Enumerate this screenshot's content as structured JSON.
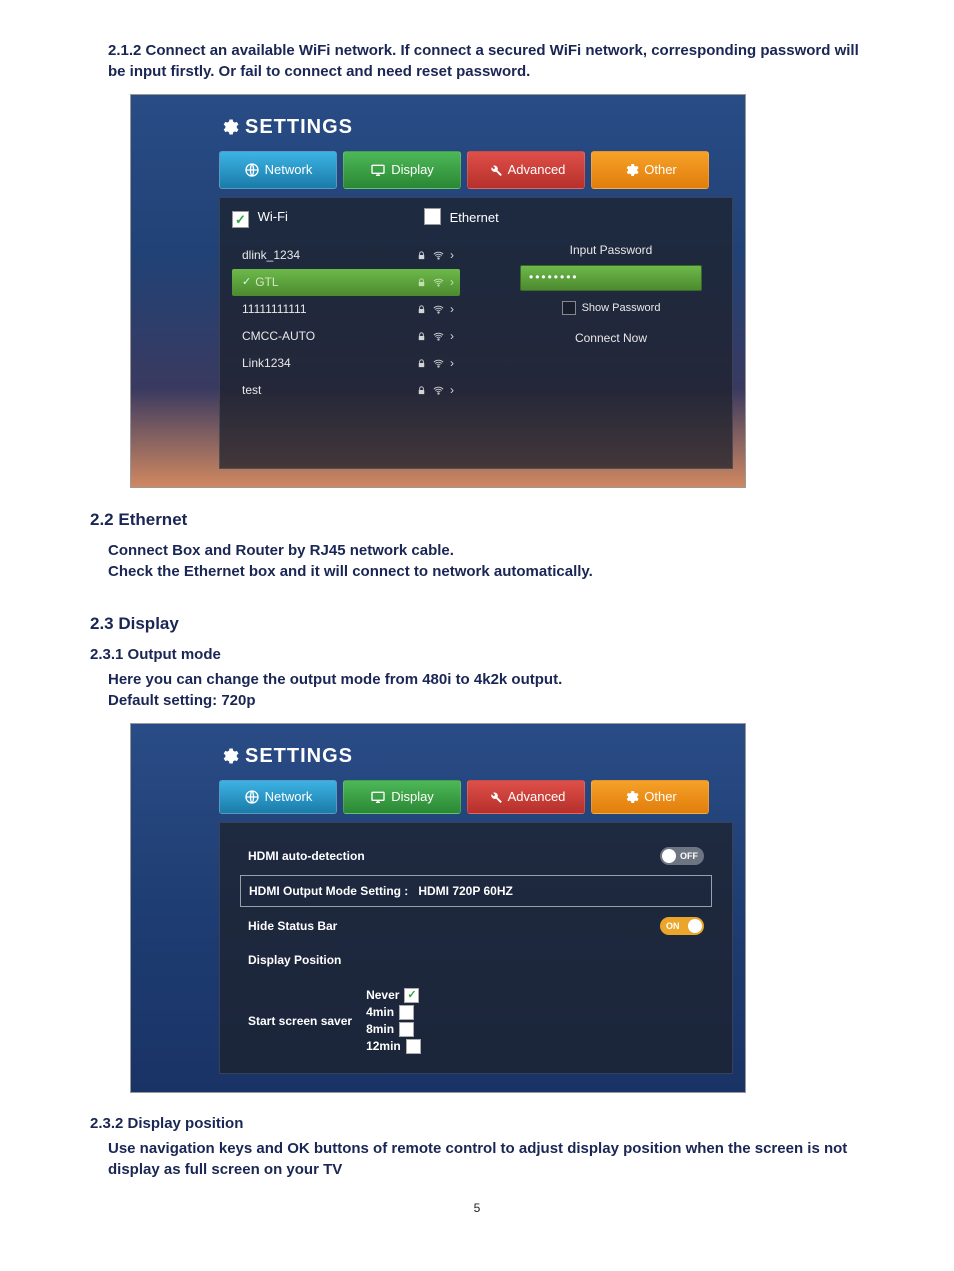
{
  "section_212": "2.1.2 Connect an available WiFi network. If connect a secured WiFi network, corresponding password will be input firstly. Or fail to connect and need reset password.",
  "shot1": {
    "title": "SETTINGS",
    "tabs": {
      "network": "Network",
      "display": "Display",
      "advanced": "Advanced",
      "other": "Other"
    },
    "wifi_label": "Wi-Fi",
    "ethernet_label": "Ethernet",
    "networks": [
      {
        "name": "dlink_1234",
        "selected": false
      },
      {
        "name": "GTL",
        "selected": true
      },
      {
        "name": "11111111111",
        "selected": false
      },
      {
        "name": "CMCC-AUTO",
        "selected": false
      },
      {
        "name": "Link1234",
        "selected": false
      },
      {
        "name": "test",
        "selected": false
      }
    ],
    "input_password_label": "Input Password",
    "password_value": "••••••••",
    "show_password_label": "Show Password",
    "connect_now": "Connect Now"
  },
  "heading_22": "2.2 Ethernet",
  "text_22a": "Connect Box and Router by RJ45 network cable.",
  "text_22b": "Check the Ethernet box and it will connect to network automatically.",
  "heading_23": "2.3 Display",
  "heading_231": "2.3.1 Output mode",
  "text_231a": "Here you can change the output mode from 480i to 4k2k output.",
  "text_231b": "Default setting: 720p",
  "shot2": {
    "title": "SETTINGS",
    "tabs": {
      "network": "Network",
      "display": "Display",
      "advanced": "Advanced",
      "other": "Other"
    },
    "hdmi_auto": "HDMI auto-detection",
    "off": "OFF",
    "hdmi_mode_label": "HDMI Output Mode Setting :",
    "hdmi_mode_value": "HDMI 720P 60HZ",
    "hide_status": "Hide Status Bar",
    "on": "ON",
    "display_position": "Display Position",
    "saver_label": "Start screen saver",
    "saver_options": [
      "Never",
      "4min",
      "8min",
      "12min"
    ],
    "saver_selected": 0
  },
  "heading_232": "2.3.2 Display position",
  "text_232": "Use navigation keys and OK buttons of remote control to adjust display position when the screen is not display as full screen on your TV",
  "page_number": "5"
}
